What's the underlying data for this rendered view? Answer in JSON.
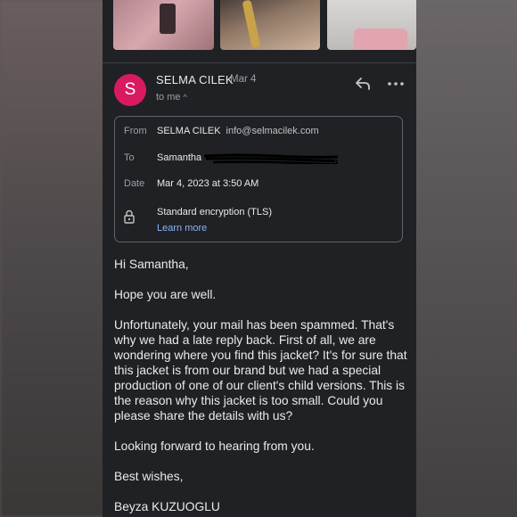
{
  "email": {
    "sender_initial": "S",
    "sender_name": "SELMA CILEK",
    "date_short": "Mar 4",
    "to_me": "to me",
    "details": {
      "from_label": "From",
      "from_name": "SELMA CILEK",
      "from_email": "info@selmacilek.com",
      "to_label": "To",
      "to_name": "Samantha",
      "date_label": "Date",
      "date_value": "Mar 4, 2023 at 3:50 AM",
      "encryption": "Standard encryption (TLS)",
      "learn_more": "Learn more"
    },
    "body": {
      "greeting": "Hi Samantha,",
      "p1": "Hope you are well.",
      "p2": "Unfortunately, your mail has been spammed. That's why we had a late reply back. First of all, we are wondering where you find this jacket? It's for sure that this jacket is from our brand but we had a special production of one of our client's child versions. This is the reason why this jacket is too small. Could you please share the details with us?",
      "p3": "Looking forward to hearing from you.",
      "signoff": "Best wishes,",
      "signature": "Beyza KUZUOGLU"
    }
  },
  "colors": {
    "avatar": "#d81b60",
    "background": "#202124",
    "link": "#8ab4f8"
  },
  "icons": [
    "reply-icon",
    "more-vert-icon",
    "lock-icon",
    "chevron-up-icon"
  ]
}
